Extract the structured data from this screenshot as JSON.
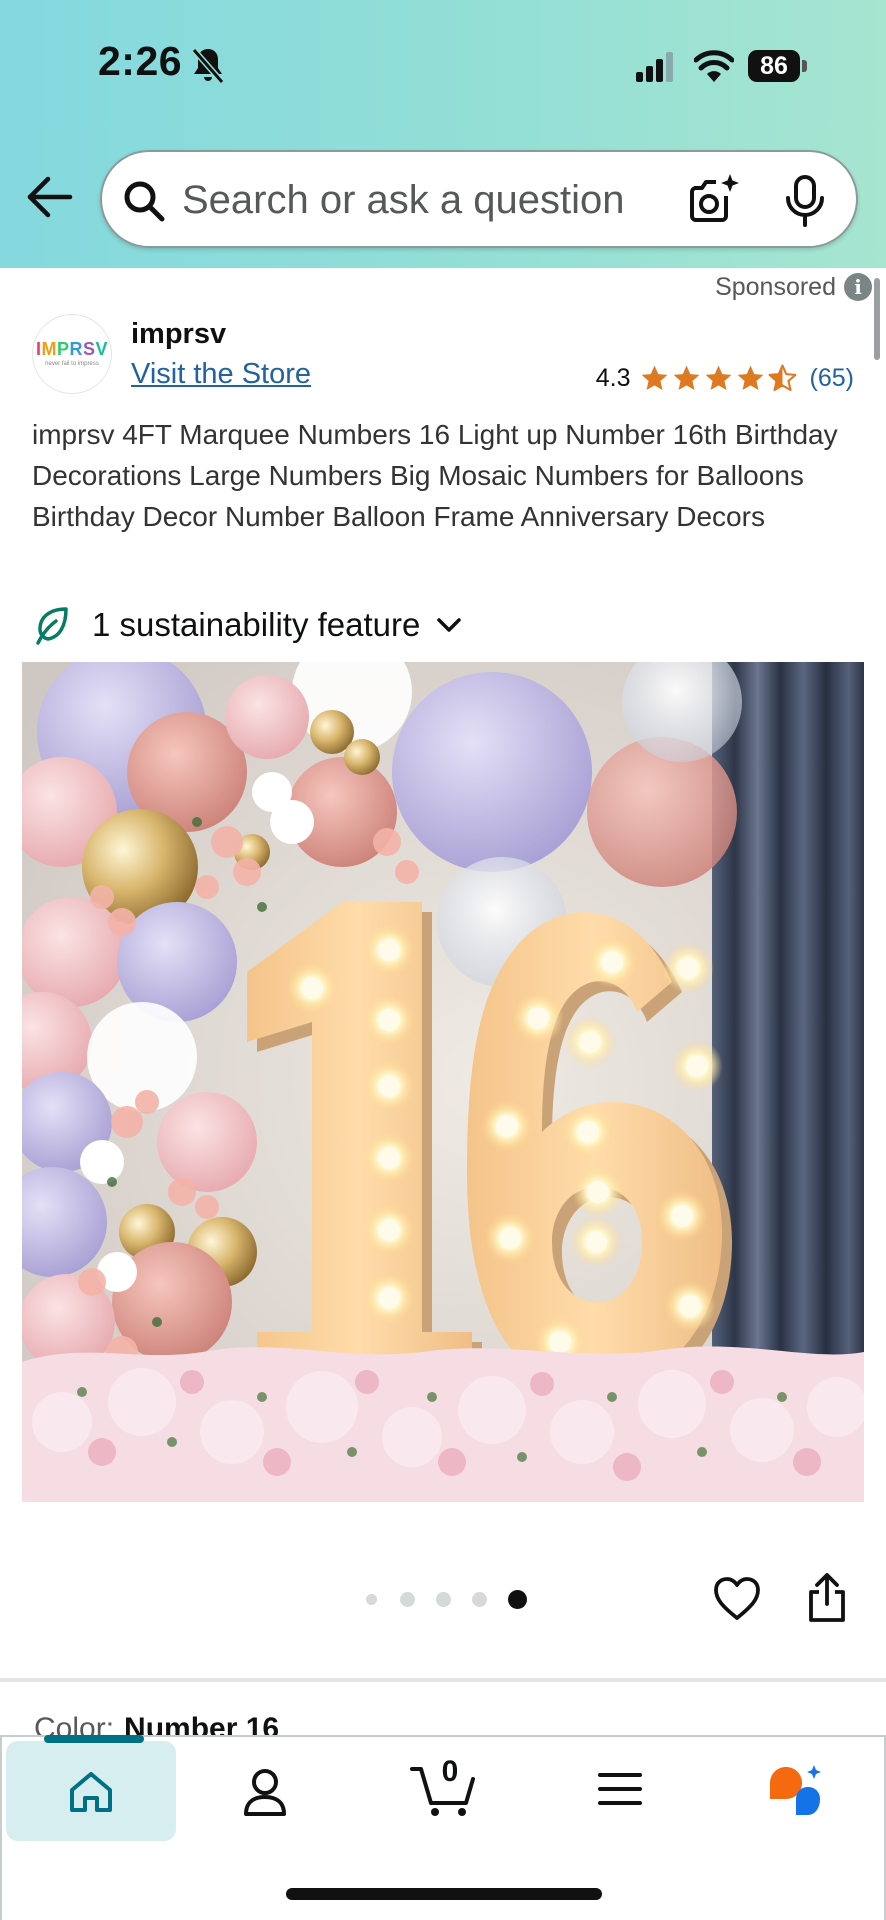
{
  "status_bar": {
    "time": "2:26",
    "battery": "86",
    "icons": [
      "bell-slash-icon",
      "signal-icon",
      "wifi-icon",
      "battery-icon"
    ]
  },
  "search": {
    "placeholder": "Search or ask a question",
    "icons": [
      "back-arrow-icon",
      "search-icon",
      "camera-icon",
      "mic-icon"
    ]
  },
  "product": {
    "sponsored_label": "Sponsored",
    "brand": {
      "logo_text": "IMPRSV",
      "logo_tagline": "never fail to impress",
      "name": "imprsv",
      "store_link": "Visit the Store"
    },
    "rating": {
      "value": "4.3",
      "stars": 4.3,
      "count": "(65)",
      "color": "#de7921"
    },
    "title": "imprsv 4FT Marquee Numbers 16 Light up Number 16th Birthday Decorations Large Numbers Big Mosaic Numbers for Balloons Birthday Decor Number Balloon Frame Anniversary Decors",
    "sustainability": "1 sustainability feature",
    "image": {
      "numbers": "16"
    },
    "carousel": {
      "total": 5,
      "active_index": 4
    },
    "color": {
      "label": "Color:",
      "value": "Number 16"
    }
  },
  "bottom_nav": {
    "items": [
      "home-icon",
      "profile-icon",
      "cart-icon",
      "menu-icon",
      "rufus-icon"
    ],
    "cart_count": "0",
    "accent": "#007185"
  }
}
